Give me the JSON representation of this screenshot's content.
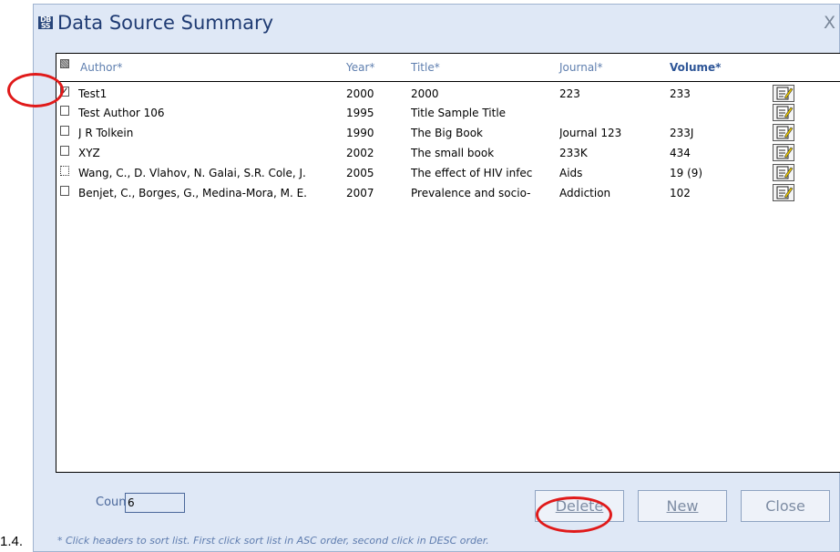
{
  "outside_label": "1.4.",
  "window": {
    "title": "Data Source Summary",
    "close_glyph": "X",
    "icon_text_top": "DB",
    "icon_text_bottom": "SS"
  },
  "table": {
    "headers": {
      "author": "Author*",
      "year": "Year*",
      "title": "Title*",
      "journal": "Journal*",
      "volume": "Volume*"
    },
    "rows": [
      {
        "checked": true,
        "dotted": false,
        "author": "Test1",
        "year": "2000",
        "title": "2000",
        "journal": "223",
        "volume": "233"
      },
      {
        "checked": false,
        "dotted": false,
        "author": "Test Author 106",
        "year": "1995",
        "title": "Title Sample Title",
        "journal": "",
        "volume": ""
      },
      {
        "checked": false,
        "dotted": false,
        "author": "J R Tolkein",
        "year": "1990",
        "title": "The Big Book",
        "journal": "Journal 123",
        "volume": "233J"
      },
      {
        "checked": false,
        "dotted": false,
        "author": "XYZ",
        "year": "2002",
        "title": "The small book",
        "journal": "233K",
        "volume": "434"
      },
      {
        "checked": false,
        "dotted": true,
        "author": "Wang, C., D. Vlahov, N. Galai, S.R. Cole, J.",
        "year": "2005",
        "title": "The effect of HIV infec",
        "journal": "Aids",
        "volume": "19 (9)"
      },
      {
        "checked": false,
        "dotted": false,
        "author": "Benjet, C., Borges, G., Medina-Mora, M. E.",
        "year": "2007",
        "title": "Prevalence and socio-",
        "journal": "Addiction",
        "volume": "102"
      }
    ]
  },
  "footer": {
    "count_label": "Count",
    "count_value": "6",
    "delete_label": "Delete",
    "new_label": "New",
    "close_label": "Close",
    "hint": "* Click headers to sort list. First click sort list in ASC order, second click in DESC order."
  },
  "colors": {
    "dialog_bg": "#dfe8f6",
    "title": "#1f3b73",
    "header_text": "#5f7faf",
    "annotation_red": "#e01a1a"
  },
  "icons": {
    "row_edit": "edit-note-icon",
    "window_close": "close-icon",
    "app": "app-icon"
  }
}
